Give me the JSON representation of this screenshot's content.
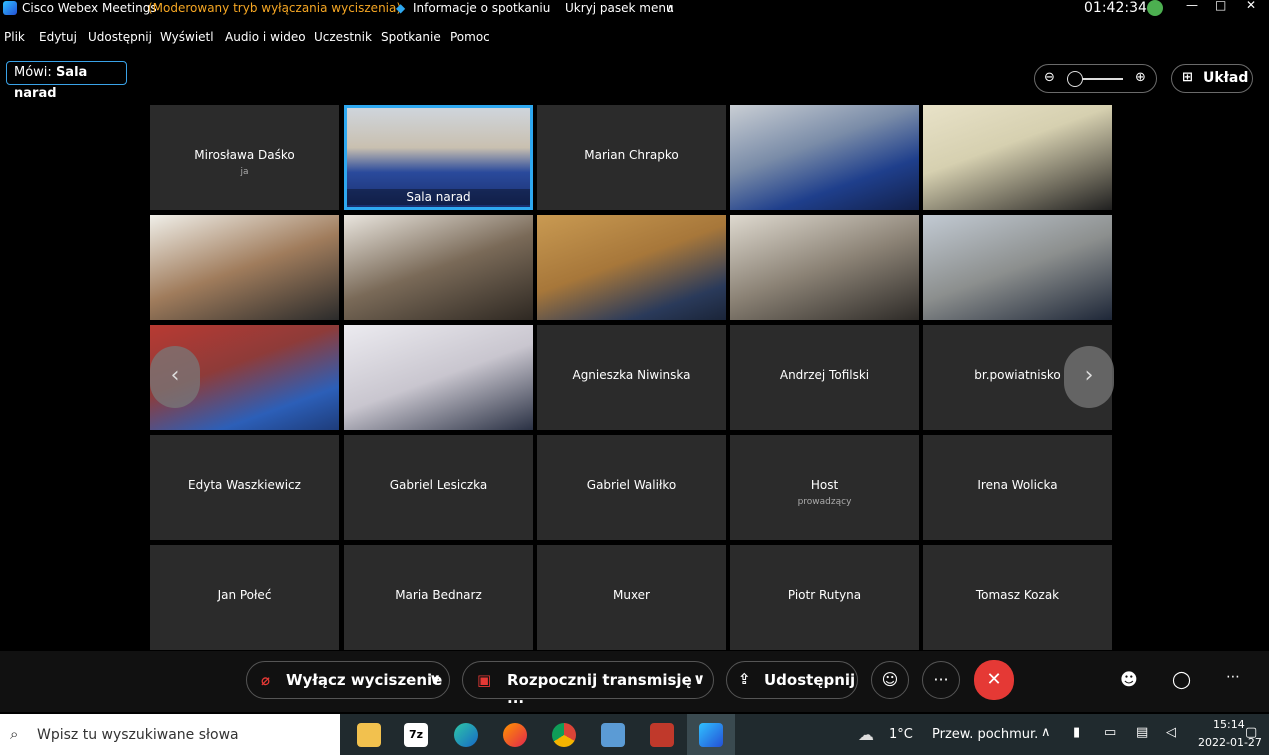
{
  "window": {
    "app_name": "Cisco Webex Meetings",
    "mode": "(Moderowany tryb wyłączania wyciszenia)",
    "meeting_info": "Informacje o spotkaniu",
    "hide_menu": "Ukryj pasek menu",
    "timer": "01:42:34"
  },
  "menu": [
    "Plik",
    "Edytuj",
    "Udostępnij",
    "Wyświetl",
    "Audio i wideo",
    "Uczestnik",
    "Spotkanie",
    "Pomoc"
  ],
  "speaking": {
    "label": "Mówi:",
    "name": "Sala narad"
  },
  "layout_button": "Układ",
  "tiles": [
    {
      "name": "Mirosława Daśko",
      "sub": "ja",
      "video": false
    },
    {
      "name": "Sala narad",
      "video": true,
      "active": true
    },
    {
      "name": "Marian Chrapko",
      "video": false
    },
    {
      "name": "",
      "video": true
    },
    {
      "name": "",
      "video": true
    },
    {
      "name": "",
      "video": true
    },
    {
      "name": "",
      "video": true
    },
    {
      "name": "",
      "video": true
    },
    {
      "name": "",
      "video": true
    },
    {
      "name": "",
      "video": true
    },
    {
      "name": "",
      "video": true
    },
    {
      "name": "",
      "video": true
    },
    {
      "name": "Agnieszka Niwinska",
      "video": false
    },
    {
      "name": "Andrzej Tofilski",
      "video": false
    },
    {
      "name": "br.powiatnisko",
      "video": false
    },
    {
      "name": "Edyta Waszkiewicz",
      "video": false
    },
    {
      "name": "Gabriel Lesiczka",
      "video": false
    },
    {
      "name": "Gabriel Waliłko",
      "video": false
    },
    {
      "name": "Host",
      "sub": "prowadzący",
      "video": false
    },
    {
      "name": "Irena Wolicka",
      "video": false
    },
    {
      "name": "Jan Połeć",
      "video": false
    },
    {
      "name": "Maria Bednarz",
      "video": false
    },
    {
      "name": "Muxer",
      "video": false
    },
    {
      "name": "Piotr Rutyna",
      "video": false
    },
    {
      "name": "Tomasz Kozak",
      "video": false
    }
  ],
  "controls": {
    "unmute": "Wyłącz wyciszenie",
    "start_video": "Rozpocznij transmisję ...",
    "share": "Udostępnij",
    "more": "···"
  },
  "taskbar": {
    "search_placeholder": "Wpisz tu wyszukiwane słowa",
    "weather_temp": "1°C",
    "weather_text": "Przew. pochmur.",
    "time": "15:14",
    "date": "2022-01-27"
  },
  "colors": {
    "accent": "#2ea8f0",
    "mode_text": "#f5a623",
    "leave": "#e53935",
    "tile_bg": "#2b2b2b"
  }
}
